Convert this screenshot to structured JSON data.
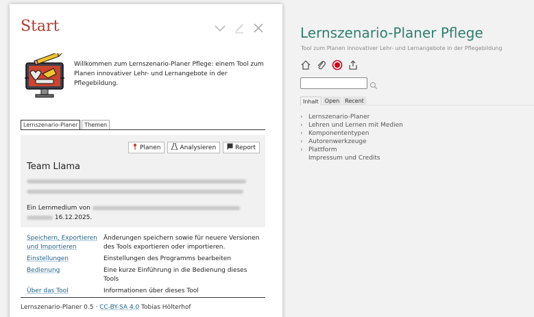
{
  "start": {
    "title": "Start",
    "intro": "Willkommen zum Lernszenario-Planer Pflege: einem Tool zum Planen innovativer Lehr- und Lernangebote in der Pflegebildung.",
    "tabs": [
      "Lernszenario-Planer",
      "Themen"
    ],
    "panel": {
      "buttons": [
        {
          "label": "Planen",
          "icon": "pin-icon"
        },
        {
          "label": "Analysieren",
          "icon": "flask-icon"
        },
        {
          "label": "Report",
          "icon": "report-icon"
        }
      ],
      "team": "Team Llama",
      "lernmedium_prefix": "Ein Lernmedium von",
      "date": "16.12.2025."
    },
    "links": [
      {
        "label": "Speichern, Exportieren und Importieren",
        "desc": "Änderungen speichern sowie für neuere Versionen des Tools exportieren oder importieren."
      },
      {
        "label": "Einstellungen",
        "desc": "Einstellungen des Programms bearbeiten"
      },
      {
        "label": "Bedienung",
        "desc": "Eine kurze Einführung in die Bedienung dieses Tools"
      },
      {
        "label": "Über das Tool",
        "desc": "Informationen über dieses Tool"
      }
    ],
    "footer": {
      "prefix": "Lernszenario-Planer 0.5 ·",
      "license": "CC-BY-SA 4.0",
      "author": "Tobias Hölterhof"
    }
  },
  "app": {
    "title": "Lernszenario-Planer Pflege",
    "subtitle": "Tool zum Planen innovativer Lehr- und Lernangebote in der Pflegebildung",
    "icons": [
      "home-icon",
      "paperclip-icon",
      "record-icon",
      "share-icon"
    ],
    "search": {
      "value": "",
      "placeholder": ""
    },
    "tabs": [
      "Inhalt",
      "Open",
      "Recent"
    ],
    "tree": [
      {
        "label": "Lernszenario-Planer",
        "expandable": true
      },
      {
        "label": "Lehren und Lernen mit Medien",
        "expandable": true
      },
      {
        "label": "Komponententypen",
        "expandable": true
      },
      {
        "label": "Autorenwerkzeuge",
        "expandable": true
      },
      {
        "label": "Plattform",
        "expandable": true
      },
      {
        "label": "Impressum und Credits",
        "expandable": false
      }
    ]
  },
  "colors": {
    "title_red": "#b03a2e",
    "app_green": "#2f7f6d",
    "link_blue": "#1f5f8a"
  }
}
